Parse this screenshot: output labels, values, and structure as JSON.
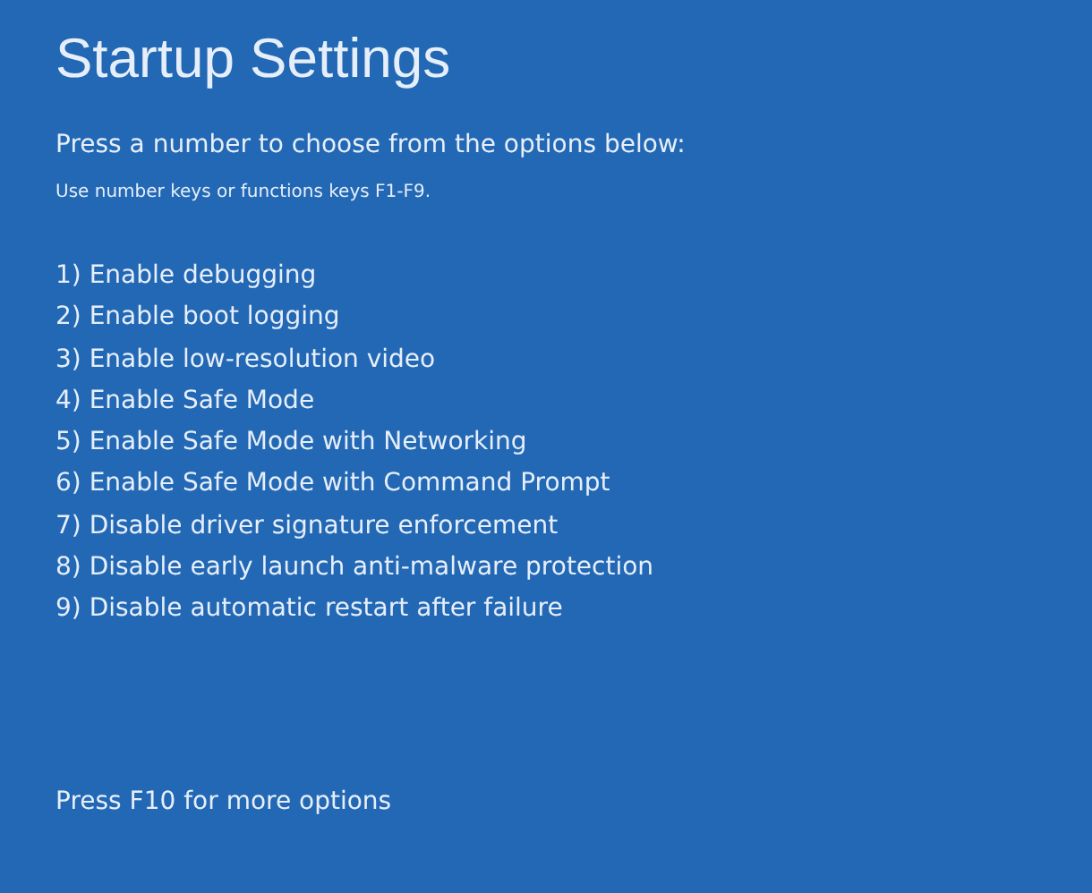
{
  "title": "Startup Settings",
  "prompt": "Press a number to choose from the options below:",
  "hint": "Use number keys or functions keys F1-F9.",
  "options": [
    "1) Enable debugging",
    "2) Enable boot logging",
    "3) Enable low-resolution video",
    "4) Enable Safe Mode",
    "5) Enable Safe Mode with Networking",
    "6) Enable Safe Mode with Command Prompt",
    "7) Disable driver signature enforcement",
    "8) Disable early launch anti-malware protection",
    "9) Disable automatic restart after failure"
  ],
  "footer": "Press F10 for more options"
}
